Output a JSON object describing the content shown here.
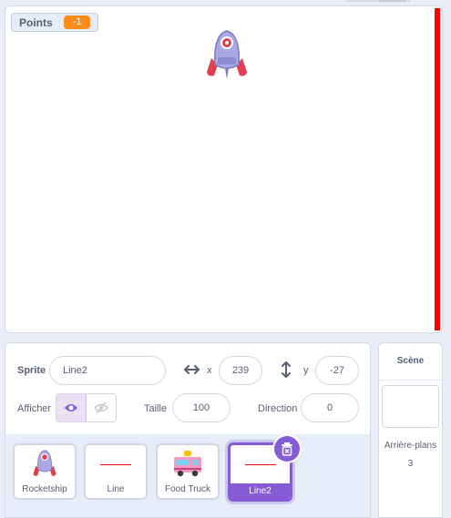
{
  "stage": {
    "monitor": {
      "label": "Points",
      "value": "-1"
    },
    "sprite_icon": "rocketship"
  },
  "sprite_info": {
    "sprite_label": "Sprite",
    "sprite_name": "Line2",
    "x_label": "x",
    "x_value": "239",
    "y_label": "y",
    "y_value": "-27",
    "show_label": "Afficher",
    "size_label": "Taille",
    "size_value": "100",
    "direction_label": "Direction",
    "direction_value": "0"
  },
  "sprites": [
    {
      "name": "Rocketship",
      "thumb": "rocketship-icon",
      "selected": false
    },
    {
      "name": "Line",
      "thumb": "red-line-icon",
      "selected": false
    },
    {
      "name": "Food Truck",
      "thumb": "food-truck-icon",
      "selected": false
    },
    {
      "name": "Line2",
      "thumb": "red-line-icon",
      "selected": true
    }
  ],
  "scene": {
    "title": "Scène",
    "backdrops_label": "Arrière-plans",
    "backdrops_count": "3"
  },
  "colors": {
    "accent": "#855cd6",
    "monitor": "#ff8c1a",
    "line": "#ff0000"
  }
}
